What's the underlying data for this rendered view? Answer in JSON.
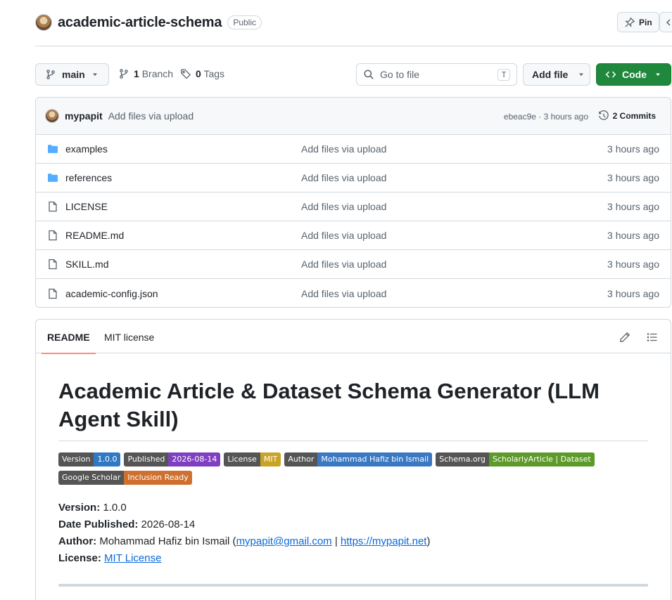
{
  "repo": {
    "name": "academic-article-schema",
    "visibility": "Public",
    "pin_label": "Pin"
  },
  "toolbar": {
    "branch": "main",
    "branch_count": "1",
    "branch_label": "Branch",
    "tag_count": "0",
    "tag_label": "Tags",
    "goto_placeholder": "Go to file",
    "goto_shortcut": "T",
    "add_file_label": "Add file",
    "code_label": "Code"
  },
  "latest_commit": {
    "author": "mypapit",
    "message": "Add files via upload",
    "meta": "ebeac9e · 3 hours ago",
    "commits_label": "2 Commits"
  },
  "files": [
    {
      "name": "examples",
      "type": "folder",
      "commit": "Add files via upload",
      "time": "3 hours ago"
    },
    {
      "name": "references",
      "type": "folder",
      "commit": "Add files via upload",
      "time": "3 hours ago"
    },
    {
      "name": "LICENSE",
      "type": "file",
      "commit": "Add files via upload",
      "time": "3 hours ago"
    },
    {
      "name": "README.md",
      "type": "file",
      "commit": "Add files via upload",
      "time": "3 hours ago"
    },
    {
      "name": "SKILL.md",
      "type": "file",
      "commit": "Add files via upload",
      "time": "3 hours ago"
    },
    {
      "name": "academic-config.json",
      "type": "file",
      "commit": "Add files via upload",
      "time": "3 hours ago"
    }
  ],
  "readme": {
    "tabs": [
      "README",
      "MIT license"
    ],
    "title": "Academic Article & Dataset Schema Generator (LLM Agent Skill)",
    "badges": [
      {
        "label": "Version",
        "value": "1.0.0",
        "color": "#2f78c4"
      },
      {
        "label": "Published",
        "value": "2026-08-14",
        "color": "#7f3fbf"
      },
      {
        "label": "License",
        "value": "MIT",
        "color": "#c9a227"
      },
      {
        "label": "Author",
        "value": "Mohammad Hafiz bin Ismail",
        "color": "#3a78c2"
      },
      {
        "label": "Schema.org",
        "value": "ScholarlyArticle | Dataset",
        "color": "#5d9a2a"
      },
      {
        "label": "Google Scholar",
        "value": "Inclusion Ready",
        "color": "#d0702e"
      }
    ],
    "meta": {
      "version_label": "Version:",
      "version": "1.0.0",
      "date_label": "Date Published:",
      "date": "2026-08-14",
      "author_label": "Author:",
      "author_name": "Mohammad Hafiz bin Ismail (",
      "author_email": "mypapit@gmail.com",
      "author_sep": " | ",
      "author_site": "https://mypapit.net",
      "author_close": ")",
      "license_label": "License:",
      "license_link": "MIT License"
    }
  },
  "colors": {
    "accent_green": "#1f883d",
    "link_blue": "#0969da",
    "folder_blue": "#54aeff",
    "tab_underline": "#fd8c73"
  }
}
